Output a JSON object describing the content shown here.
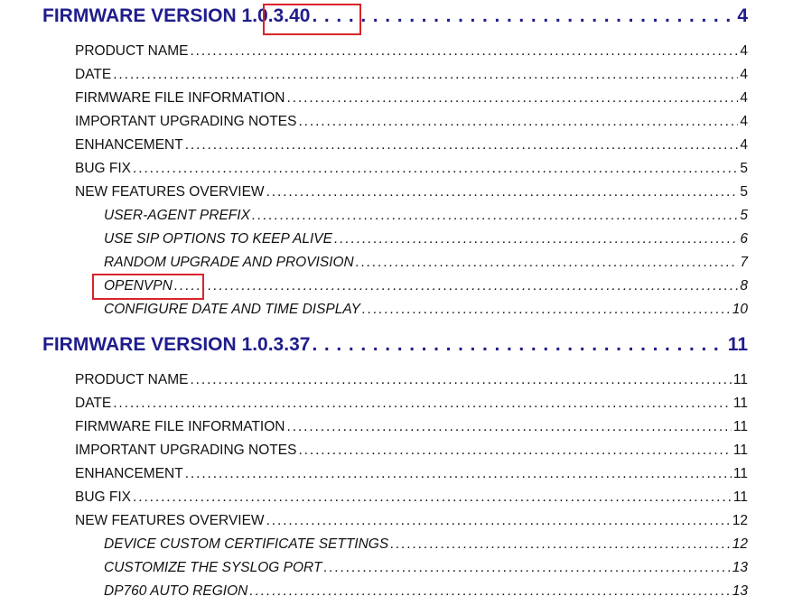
{
  "sections": [
    {
      "title": "FIRMWARE VERSION",
      "version": "1.0.3.40",
      "page": "4",
      "entries": [
        {
          "label": "PRODUCT NAME",
          "page": "4"
        },
        {
          "label": "DATE",
          "page": "4"
        },
        {
          "label": "FIRMWARE FILE INFORMATION",
          "page": "4"
        },
        {
          "label": "IMPORTANT UPGRADING NOTES",
          "page": "4"
        },
        {
          "label": "ENHANCEMENT",
          "page": "4"
        },
        {
          "label": "BUG FIX",
          "page": "5"
        },
        {
          "label": "NEW FEATURES OVERVIEW",
          "page": "5"
        }
      ],
      "features": [
        {
          "label": "USER-AGENT PREFIX",
          "page": "5"
        },
        {
          "label": "USE SIP OPTIONS TO KEEP ALIVE",
          "page": "6"
        },
        {
          "label": "RANDOM UPGRADE AND PROVISION",
          "page": "7"
        },
        {
          "label": "OPENVPN",
          "page": "8"
        },
        {
          "label": "CONFIGURE DATE AND TIME DISPLAY",
          "page": "10"
        }
      ]
    },
    {
      "title": "FIRMWARE VERSION",
      "version": "1.0.3.37",
      "page": "11",
      "entries": [
        {
          "label": "PRODUCT NAME",
          "page": "11"
        },
        {
          "label": "DATE",
          "page": "11"
        },
        {
          "label": "FIRMWARE FILE INFORMATION",
          "page": "11"
        },
        {
          "label": "IMPORTANT UPGRADING NOTES",
          "page": "11"
        },
        {
          "label": "ENHANCEMENT",
          "page": "11"
        },
        {
          "label": "BUG FIX",
          "page": "11"
        },
        {
          "label": "NEW FEATURES OVERVIEW",
          "page": "12"
        }
      ],
      "features": [
        {
          "label": "DEVICE CUSTOM CERTIFICATE SETTINGS",
          "page": "12"
        },
        {
          "label": "CUSTOMIZE THE SYSLOG PORT",
          "page": "13"
        },
        {
          "label": "DP760 AUTO REGION",
          "page": "13"
        }
      ]
    }
  ],
  "colors": {
    "heading": "#1f1d8c",
    "highlight_box": "#d9232a",
    "text": "#111111"
  }
}
